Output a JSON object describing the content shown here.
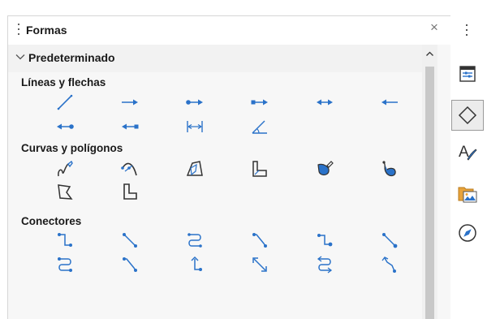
{
  "panel": {
    "title": "Formas",
    "close_glyph": "×",
    "section": {
      "label": "Predeterminado",
      "expanded": true
    },
    "groups": [
      {
        "label": "Líneas y flechas",
        "shapes": [
          "line-icon",
          "arrow-right-icon",
          "line-circle-arrow-icon",
          "line-square-arrow-icon",
          "double-arrow-icon",
          "arrow-left-icon",
          "circle-arrow-left-icon",
          "square-arrow-left-icon",
          "dimension-line-icon",
          "angle-icon"
        ]
      },
      {
        "label": "Curvas y polígonos",
        "shapes": [
          "freeform-curve-icon",
          "curve-icon",
          "polygon-icon",
          "polygon-45-icon",
          "freeform-filled-icon",
          "curve-filled-icon",
          "polygon-filled-icon",
          "polygon-45-filled-icon"
        ]
      },
      {
        "label": "Conectores",
        "shapes": [
          "connector-icon",
          "connector-straight-icon",
          "connector-curved-icon",
          "connector-line-icon",
          "connector-ends-icon",
          "connector-straight-ends-icon",
          "connector-curved-ends-icon",
          "connector-line-ends-icon",
          "connector-arrows-icon",
          "connector-straight-arrows-icon",
          "connector-curved-arrows-icon",
          "connector-line-arrows-icon"
        ]
      }
    ]
  },
  "sidebar": {
    "buttons": [
      {
        "name": "properties-icon"
      },
      {
        "name": "shapes-icon",
        "active": true
      },
      {
        "name": "styles-icon"
      },
      {
        "name": "gallery-icon"
      },
      {
        "name": "navigator-icon"
      }
    ]
  },
  "colors": {
    "accent": "#2a72c9",
    "dark_icon": "#333333"
  }
}
